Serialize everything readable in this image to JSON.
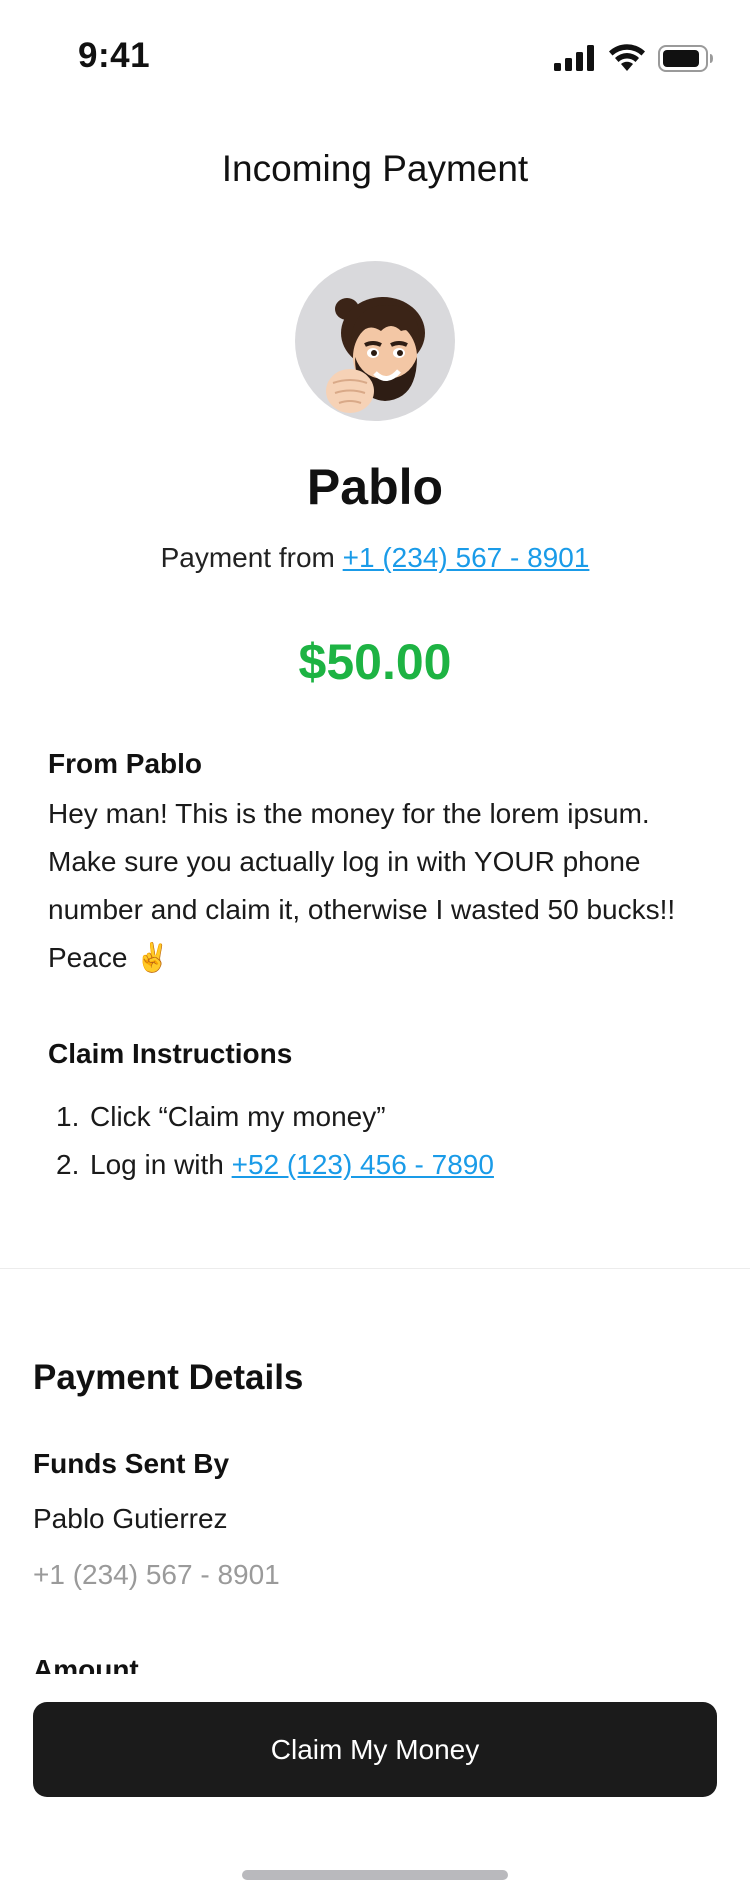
{
  "status_bar": {
    "time": "9:41",
    "signal_icon": "cellular-signal-icon",
    "wifi_icon": "wifi-icon",
    "battery_icon": "battery-icon"
  },
  "header": {
    "title": "Incoming Payment"
  },
  "sender": {
    "avatar_icon": "memoji-avatar-icon",
    "name": "Pablo",
    "from_prefix": "Payment from ",
    "phone": "+1 (234) 567 - 8901"
  },
  "payment": {
    "amount": "$50.00",
    "amount_color": "#1db343"
  },
  "note": {
    "heading": "From Pablo",
    "body": "Hey man! This is the money for the lorem ipsum. Make sure you actually log in with YOUR phone number and claim it, otherwise I wasted 50 bucks!! Peace ✌️"
  },
  "claim_instructions": {
    "heading": "Claim Instructions",
    "steps": [
      {
        "number": "1.",
        "text": "Click “Claim my money”"
      },
      {
        "number": "2.",
        "text": "Log in with ",
        "link": "+52 (123) 456 - 7890"
      }
    ]
  },
  "details": {
    "title": "Payment Details",
    "funds_sent_by_label": "Funds Sent By",
    "sender_full_name": "Pablo Gutierrez",
    "sender_phone": "+1 (234) 567 - 8901",
    "amount_label": "Amount"
  },
  "actions": {
    "claim_button": "Claim My Money"
  },
  "colors": {
    "link": "#1a9be8",
    "button_bg": "#1b1b1b",
    "muted_text": "#9a9a9a"
  }
}
